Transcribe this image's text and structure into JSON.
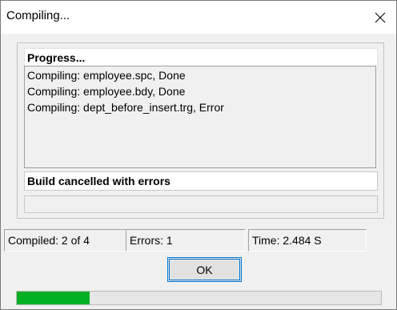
{
  "window": {
    "title": "Compiling..."
  },
  "group": {
    "heading": "Progress...",
    "log_lines": [
      "Compiling: employee.spc, Done",
      "Compiling: employee.bdy, Done",
      "Compiling: dept_before_insert.trg, Error"
    ],
    "status": "Build cancelled with errors"
  },
  "stats": {
    "compiled": "Compiled: 2 of 4",
    "errors": "Errors: 1",
    "time": "Time: 2.484 S"
  },
  "buttons": {
    "ok": "OK"
  },
  "progress": {
    "fraction": 0.2
  },
  "icons": {
    "close": "close-icon"
  },
  "colors": {
    "progress_fill": "#06b025",
    "focus_border": "#0078d7"
  }
}
